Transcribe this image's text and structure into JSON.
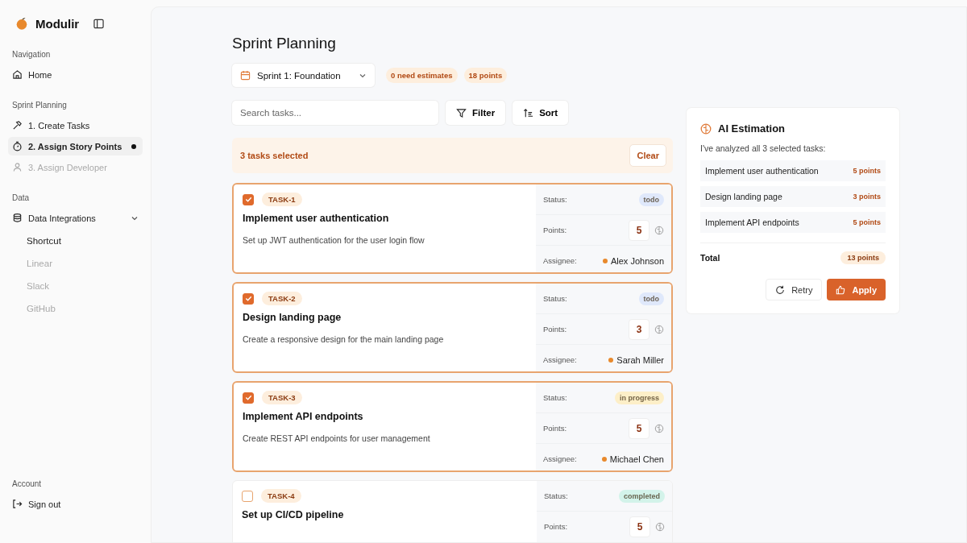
{
  "app": {
    "name": "Modulir"
  },
  "sidebar": {
    "sections": [
      {
        "title": "Navigation",
        "items": [
          {
            "label": "Home",
            "selected": false,
            "disabled": false
          }
        ]
      },
      {
        "title": "Sprint Planning",
        "items": [
          {
            "label": "1. Create Tasks",
            "selected": false,
            "disabled": false
          },
          {
            "label": "2. Assign Story Points",
            "selected": true,
            "disabled": false
          },
          {
            "label": "3. Assign Developer",
            "selected": false,
            "disabled": true
          }
        ]
      },
      {
        "title": "Data",
        "items": [
          {
            "label": "Data Integrations",
            "selected": false,
            "disabled": false,
            "expanded": true,
            "children": [
              {
                "label": "Shortcut",
                "disabled": false
              },
              {
                "label": "Linear",
                "disabled": true
              },
              {
                "label": "Slack",
                "disabled": true
              },
              {
                "label": "GitHub",
                "disabled": true
              }
            ]
          }
        ]
      }
    ],
    "account": {
      "title": "Account",
      "items": [
        {
          "label": "Sign out"
        }
      ]
    }
  },
  "page": {
    "title": "Sprint Planning",
    "sprint_select": "Sprint 1: Foundation",
    "badges": [
      "0 need estimates",
      "18 points"
    ],
    "search": {
      "placeholder": "Search tasks..."
    },
    "filter_button": "Filter",
    "sort_button": "Sort",
    "selection_bar": {
      "text": "3 tasks selected",
      "clear": "Clear"
    }
  },
  "tasks": [
    {
      "id": "TASK-1",
      "selected": true,
      "title": "Implement user authentication",
      "description": "Set up JWT authentication for the user login flow",
      "status_label": "Status:",
      "status": "todo",
      "color": "#dfe8fb",
      "points_label": "Points:",
      "points": "5",
      "assignee_label": "Assignee:",
      "assignee": "Alex Johnson"
    },
    {
      "id": "TASK-2",
      "selected": true,
      "title": "Design landing page",
      "description": "Create a responsive design for the main landing page",
      "status_label": "Status:",
      "status": "todo",
      "color": "#dfe8fb",
      "points_label": "Points:",
      "points": "3",
      "assignee_label": "Assignee:",
      "assignee": "Sarah Miller"
    },
    {
      "id": "TASK-3",
      "selected": true,
      "title": "Implement API endpoints",
      "description": "Create REST API endpoints for user management",
      "status_label": "Status:",
      "status": "in progress",
      "color": "#fdefc8",
      "points_label": "Points:",
      "points": "5",
      "assignee_label": "Assignee:",
      "assignee": "Michael Chen"
    },
    {
      "id": "TASK-4",
      "selected": false,
      "title": "Set up CI/CD pipeline",
      "status_label": "Status:",
      "status": "completed",
      "color": "#d3f3ea",
      "points_label": "Points:",
      "points": "5"
    }
  ],
  "ai_panel": {
    "title": "AI Estimation",
    "intro": "I've analyzed all 3 selected tasks:",
    "estimates": [
      {
        "task": "Implement user authentication",
        "points": "5 points"
      },
      {
        "task": "Design landing page",
        "points": "3 points"
      },
      {
        "task": "Implement API endpoints",
        "points": "5 points"
      }
    ],
    "total_label": "Total",
    "total": "13 points",
    "buttons": [
      "Retry",
      "Apply"
    ]
  }
}
